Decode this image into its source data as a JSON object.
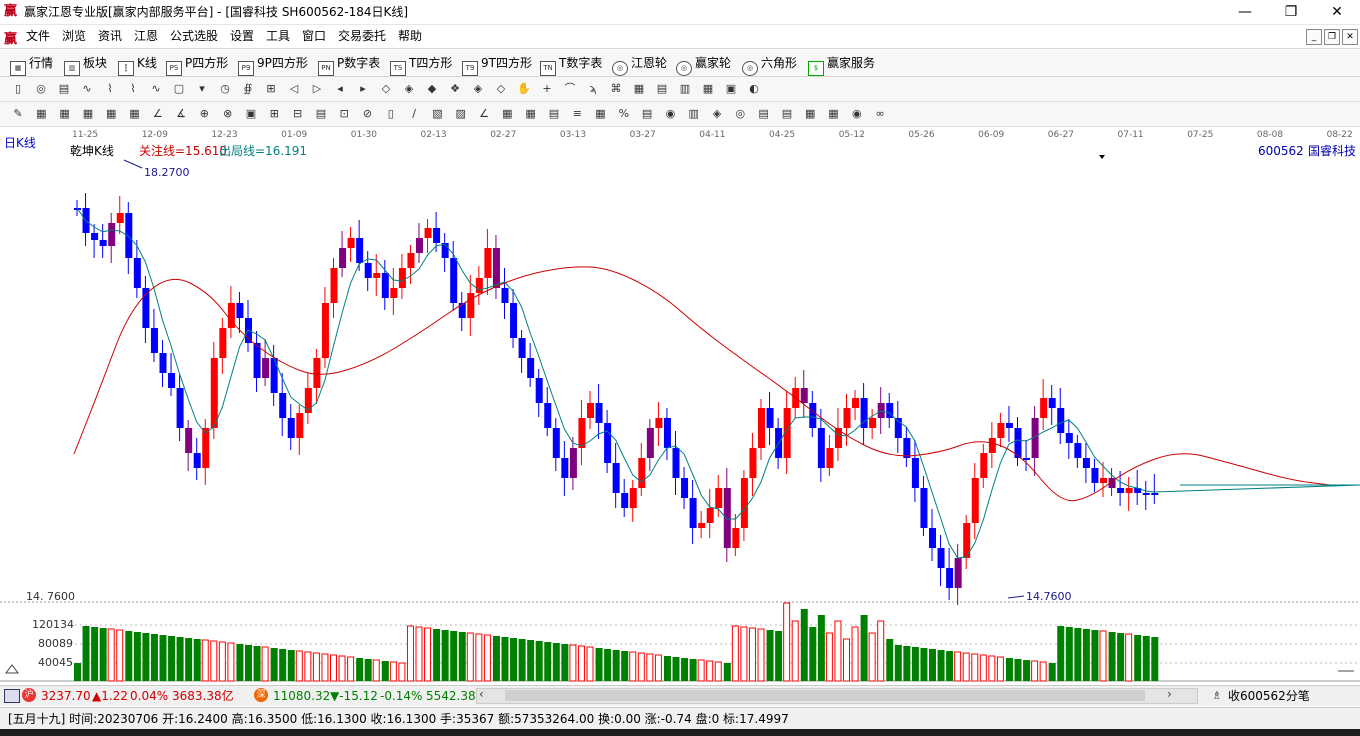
{
  "window": {
    "title": "赢家江恩专业版[赢家内部服务平台] - [国睿科技  SH600562-184日K线]",
    "logo": "赢"
  },
  "menu": {
    "logo": "赢",
    "items": [
      "文件",
      "浏览",
      "资讯",
      "江恩",
      "公式选股",
      "设置",
      "工具",
      "窗口",
      "交易委托",
      "帮助"
    ]
  },
  "nav": {
    "items": [
      {
        "icon": "▦",
        "label": "行情"
      },
      {
        "icon": "▥",
        "label": "板块"
      },
      {
        "icon": "┇",
        "label": "K线"
      },
      {
        "icon": "PS",
        "label": "P四方形"
      },
      {
        "icon": "P9",
        "label": "9P四方形"
      },
      {
        "icon": "PN",
        "label": "P数字表"
      },
      {
        "icon": "TS",
        "label": "T四方形"
      },
      {
        "icon": "T9",
        "label": "9T四方形"
      },
      {
        "icon": "TN",
        "label": "T数字表"
      },
      {
        "icon": "◎",
        "label": "江恩轮"
      },
      {
        "icon": "◎",
        "label": "赢家轮"
      },
      {
        "icon": "◎",
        "label": "六角形"
      },
      {
        "icon": "$",
        "label": "赢家服务"
      }
    ]
  },
  "chart": {
    "period_label": "日K线",
    "indicator_name": "乾坤K线",
    "focus_line": "关注线=15.610",
    "exit_line": "出局线=16.191",
    "stock": "600562",
    "stock_name": "国睿科技",
    "high_label": "18.2700",
    "low_label": "14.7600",
    "dates": [
      "11-25",
      "12-09",
      "12-23",
      "01-09",
      "01-30",
      "02-13",
      "02-27",
      "03-13",
      "03-27",
      "04-11",
      "04-25",
      "05-12",
      "05-26",
      "06-09",
      "06-27",
      "07-11",
      "07-25",
      "08-08",
      "08-22"
    ],
    "vol_axis": [
      "14. 7600",
      "120134",
      "80089",
      "40045"
    ],
    "colors": {
      "up": "#ff0000",
      "down": "#0000ff",
      "purple": "#800080",
      "ma": "#008080",
      "curve": "#cc0000",
      "vol_up": "#ff0000",
      "vol_down": "#008000"
    }
  },
  "chart_data": {
    "type": "candlestick",
    "y_range": [
      14.76,
      18.27
    ],
    "candles": [],
    "note_visible_extremes": {
      "high": 18.27,
      "low": 14.76
    }
  },
  "status1": {
    "sh_value": "3237.70",
    "sh_change": "▲1.22",
    "sh_pct": "0.04%",
    "sh_amount": "3683.38亿",
    "sz_value": "11080.32",
    "sz_change": "▼-15.12",
    "sz_pct": "-0.14%",
    "sz_amount": "5542.38",
    "right_label": "收600562分笔"
  },
  "status2": {
    "text": "[五月十九] 时间:20230706 开:16.2400 高:16.3500 低:16.1300 收:16.1300 手:35367 额:57353264.00 换:0.00 涨:-0.74 盘:0 标:17.4997"
  }
}
